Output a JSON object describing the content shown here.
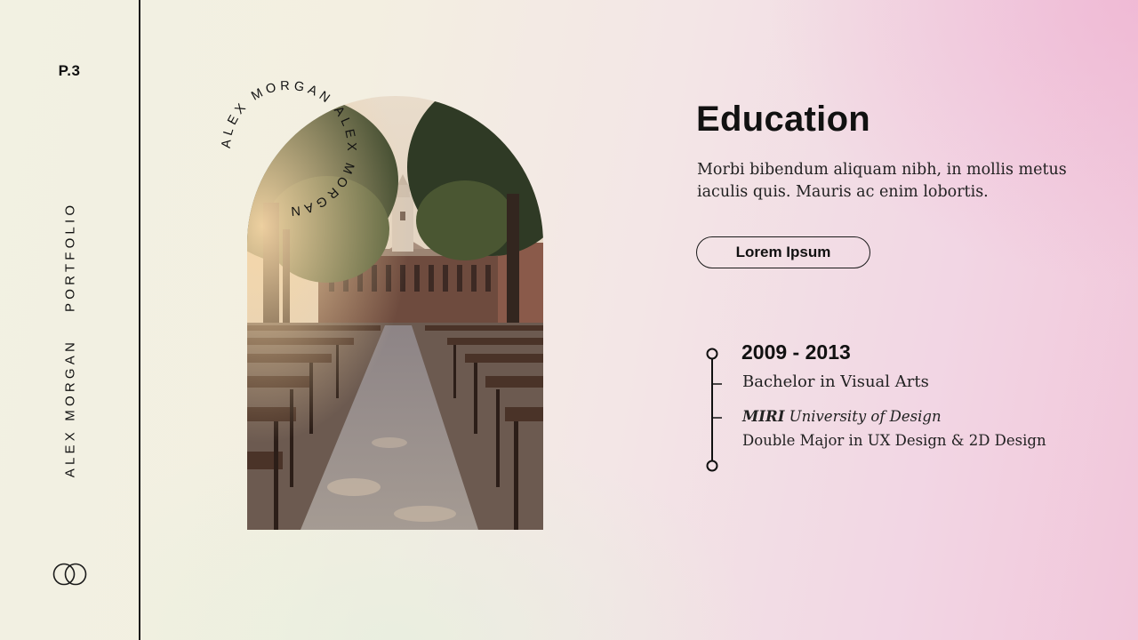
{
  "sidebar": {
    "page_number": "P.3",
    "name": "ALEX MORGAN",
    "label": "PORTFOLIO",
    "logo_icon": "interlocking-circles-logo"
  },
  "photo": {
    "circular_text": "ALEX MORGAN ALEX MORGAN ",
    "subject": "university-campus-image"
  },
  "main": {
    "title": "Education",
    "description": "Morbi bibendum aliquam nibh, in mollis metus iaculis quis. Mauris ac enim lobortis.",
    "button_label": "Lorem Ipsum"
  },
  "timeline": {
    "years": "2009 - 2013",
    "degree": "Bachelor in Visual Arts",
    "university_prefix": "MIRI",
    "university_rest": " University of Design",
    "major": "Double Major in UX Design & 2D Design"
  },
  "colors": {
    "text": "#111111",
    "background_left": "#f2f1e2",
    "background_right": "#f1c6da"
  }
}
